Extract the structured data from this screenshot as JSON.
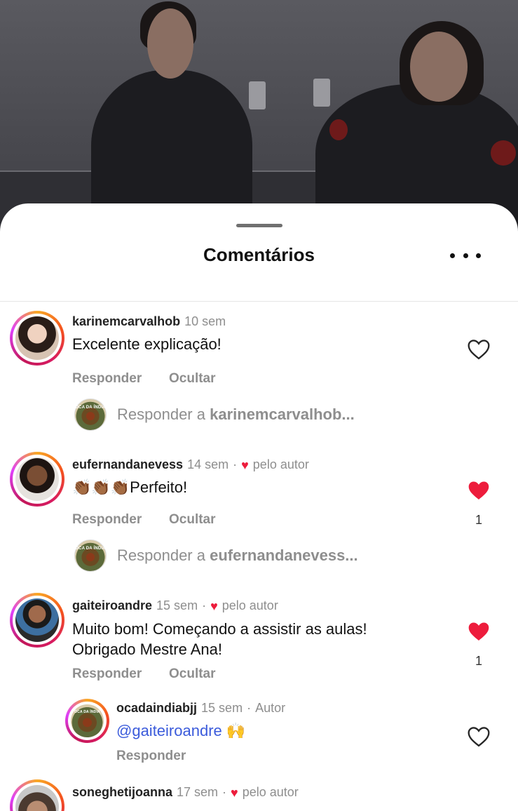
{
  "sheet": {
    "title": "Comentários",
    "more_icon": "more-horizontal-icon"
  },
  "comments": [
    {
      "username": "karinemcarvalhob",
      "time": "10 sem",
      "liked_by_author": false,
      "text": "Excelente explicação!",
      "liked": false,
      "like_count": "",
      "reply_label": "Responder",
      "hide_label": "Ocultar",
      "reply_prompt_prefix": "Responder a",
      "reply_prompt_user": "karinemcarvalhob..."
    },
    {
      "username": "eufernandanevess",
      "time": "14 sem",
      "author_badge": "pelo autor",
      "text": "👏🏾👏🏾👏🏾Perfeito!",
      "liked": true,
      "like_count": "1",
      "reply_label": "Responder",
      "hide_label": "Ocultar",
      "reply_prompt_prefix": "Responder a",
      "reply_prompt_user": "eufernandanevess..."
    },
    {
      "username": "gaiteiroandre",
      "time": "15 sem",
      "author_badge": "pelo autor",
      "text_line1": "Muito bom! Começando a assistir as aulas!",
      "text_line2": "Obrigado Mestre Ana!",
      "liked": true,
      "like_count": "1",
      "reply_label": "Responder",
      "hide_label": "Ocultar",
      "reply": {
        "username": "ocadaindiabjj",
        "time": "15 sem",
        "role": "Autor",
        "mention": "@gaiteiroandre",
        "emoji": "🙌",
        "liked": false,
        "reply_label": "Responder",
        "avatar_text": "OCA DA ÍNDIA"
      }
    },
    {
      "username": "soneghetijoanna",
      "time": "17 sem",
      "author_badge": "pelo autor"
    }
  ],
  "avatar_text": "OCA DA ÍNDIA",
  "colors": {
    "like_red": "#ed1c3c",
    "muted": "#8e8e8e",
    "mention_blue": "#3b5bdb"
  }
}
